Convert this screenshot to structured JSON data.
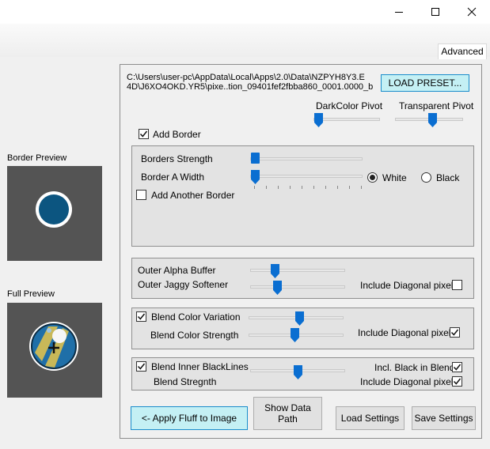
{
  "window": {
    "controls": [
      "minimize",
      "maximize",
      "close"
    ]
  },
  "tabs": {
    "advanced_label": "Advanced"
  },
  "left": {
    "border_preview_label": "Border Preview",
    "full_preview_label": "Full Preview"
  },
  "main": {
    "path_line1": "C:\\Users\\user-pc\\AppData\\Local\\Apps\\2.0\\Data\\NZPYH8Y3.E",
    "path_line2": "4D\\J6XO4OKD.YR5\\pixe..tion_09401fef2fbba860_0001.0000_b",
    "load_preset_label": "LOAD PRESET...",
    "dark_pivot_label": "DarkColor Pivot",
    "transparent_pivot_label": "Transparent Pivot",
    "add_border_label": "Add Border",
    "add_border_checked": true,
    "borders_strength_label": "Borders Strength",
    "border_a_width_label": "Border A Width",
    "white_label": "White",
    "black_label": "Black",
    "border_color": "White",
    "add_another_border_label": "Add Another Border",
    "add_another_border_checked": false,
    "outer_alpha_label": "Outer Alpha Buffer",
    "outer_jaggy_label": "Outer Jaggy Softener",
    "include_diag_1_label": "Include Diagonal pixels",
    "include_diag_1_checked": false,
    "blend_color_var_label": "Blend Color Variation",
    "blend_color_var_checked": true,
    "blend_color_strength_label": "Blend Color Strength",
    "include_diag_2_label": "Include Diagonal pixels",
    "include_diag_2_checked": true,
    "blend_inner_label": "Blend Inner BlackLines",
    "blend_inner_checked": true,
    "blend_strength_label": "Blend Stregnth",
    "incl_black_label": "Incl. Black in Blend",
    "incl_black_checked": true,
    "include_diag_3_label": "Include Diagonal pixels",
    "include_diag_3_checked": true,
    "apply_fluff_label": "<- Apply Fluff to Image",
    "show_data_path_label": "Show Data Path",
    "load_settings_label": "Load Settings",
    "save_settings_label": "Save Settings"
  },
  "colors": {
    "accent": "#0a6ed1",
    "preview_bg": "#545454",
    "apply_btn_bg": "#c4f0f4"
  }
}
